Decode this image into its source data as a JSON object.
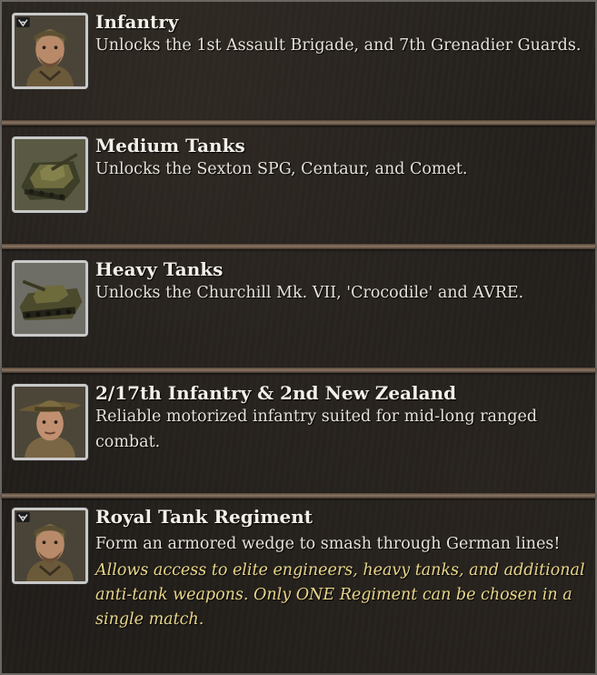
{
  "entries": [
    {
      "icon": "infantry-officer-portrait-icon",
      "title": "Infantry",
      "description": "Unlocks the 1st Assault Brigade, and 7th Grenadier Guards."
    },
    {
      "icon": "medium-tank-portrait-icon",
      "title": "Medium Tanks",
      "description": "Unlocks the Sexton SPG, Centaur, and Comet."
    },
    {
      "icon": "heavy-tank-portrait-icon",
      "title": "Heavy Tanks",
      "description": "Unlocks the Churchill Mk. VII, 'Crocodile' and AVRE."
    },
    {
      "icon": "slouch-hat-soldier-portrait-icon",
      "title": "2/17th Infantry & 2nd New Zealand",
      "description": "Reliable motorized infantry suited for mid-long ranged combat."
    },
    {
      "icon": "infantry-officer-portrait-icon",
      "title": "Royal Tank Regiment",
      "description": "Form an armored wedge to smash through German lines!",
      "note": "Allows access to elite engineers, heavy tanks, and additional anti-tank weapons. Only ONE Regiment can be chosen in a single match."
    }
  ],
  "colors": {
    "title": "#f2efe8",
    "description": "#e6e2da",
    "note": "#e8d68a",
    "divider": "#8c7663"
  }
}
